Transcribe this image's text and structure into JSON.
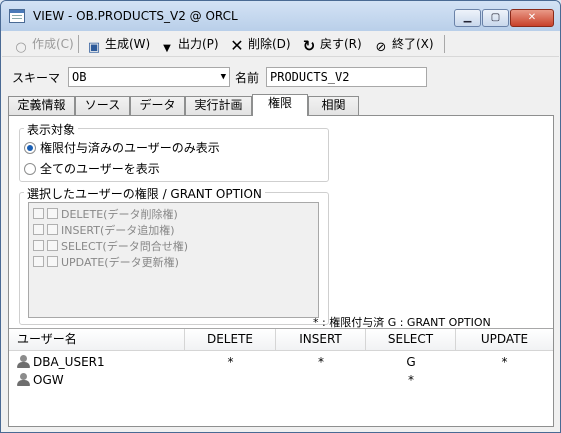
{
  "window": {
    "title": "VIEW - OB.PRODUCTS_V2 @ ORCL",
    "controls": {
      "minimize": "▁",
      "maximize": "▢",
      "close": "✕"
    }
  },
  "toolbar": {
    "create": {
      "label": "作成(C)",
      "icon": "create-icon",
      "enabled": false
    },
    "generate": {
      "label": "生成(W)",
      "icon": "generate-icon"
    },
    "output": {
      "label": "出力(P)",
      "icon": "output-dropdown-icon"
    },
    "delete": {
      "label": "削除(D)",
      "icon": "delete-icon"
    },
    "back": {
      "label": "戻す(R)",
      "icon": "undo-icon"
    },
    "exit": {
      "label": "終了(X)",
      "icon": "exit-icon"
    }
  },
  "form": {
    "schema_label": "スキーマ",
    "schema_value": "OB",
    "name_label": "名前",
    "name_value": "PRODUCTS_V2"
  },
  "tabs": [
    {
      "label": "定義情報"
    },
    {
      "label": "ソース"
    },
    {
      "label": "データ"
    },
    {
      "label": "実行計画"
    },
    {
      "label": "権限",
      "active": true
    },
    {
      "label": "相関"
    }
  ],
  "display_target": {
    "title": "表示対象",
    "options": [
      {
        "label": "権限付与済みのユーザーのみ表示",
        "selected": true
      },
      {
        "label": "全てのユーザーを表示",
        "selected": false
      }
    ]
  },
  "privileges": {
    "title": "選択したユーザーの権限 / GRANT OPTION",
    "items": [
      {
        "label": "DELETE(データ削除権)"
      },
      {
        "label": "INSERT(データ追加権)"
      },
      {
        "label": "SELECT(データ問合せ権)"
      },
      {
        "label": "UPDATE(データ更新権)"
      }
    ]
  },
  "legend": "* : 権限付与済  G : GRANT OPTION",
  "grid": {
    "columns": [
      "ユーザー名",
      "DELETE",
      "INSERT",
      "SELECT",
      "UPDATE"
    ],
    "rows": [
      {
        "user": "DBA_USER1",
        "delete": "*",
        "insert": "*",
        "select": "G",
        "update": "*"
      },
      {
        "user": "OGW",
        "delete": "",
        "insert": "",
        "select": "*",
        "update": ""
      }
    ]
  },
  "colors": {
    "accent": "#1a5fb4",
    "title_bar": "#b9cfe9",
    "close_button": "#c8412a"
  }
}
